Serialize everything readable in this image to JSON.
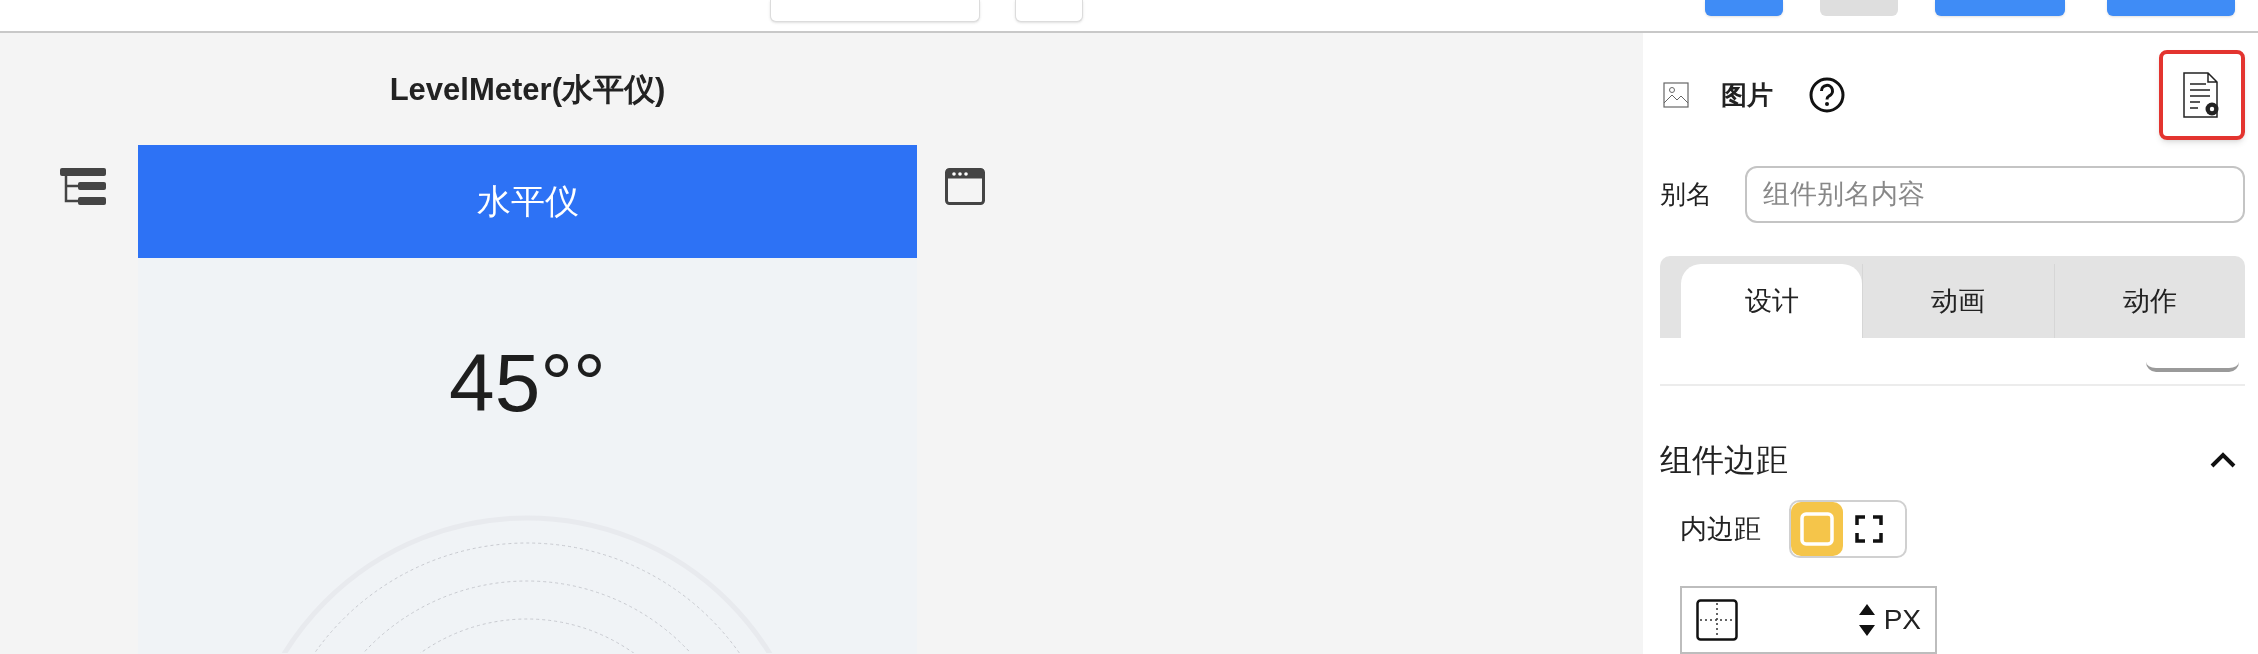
{
  "toolbar": {
    "controls": [
      {
        "kind": "select"
      },
      {
        "kind": "icon"
      },
      {
        "kind": "primary"
      },
      {
        "kind": "secondary"
      },
      {
        "kind": "primary"
      },
      {
        "kind": "primary"
      }
    ]
  },
  "canvas": {
    "title": "LevelMeter(水平仪)",
    "screen": {
      "header": "水平仪",
      "reading": "45°°"
    }
  },
  "inspector": {
    "component": "图片",
    "alias": {
      "label": "别名",
      "placeholder": "组件别名内容"
    },
    "tabs": [
      {
        "label": "设计",
        "selected": true
      },
      {
        "label": "动画",
        "selected": false
      },
      {
        "label": "动作",
        "selected": false
      }
    ],
    "section": {
      "title": "组件边距",
      "expanded": true,
      "padding": {
        "label": "内边距",
        "modes": [
          {
            "kind": "uniform",
            "selected": true
          },
          {
            "kind": "separate",
            "selected": false
          }
        ],
        "unit": "PX"
      }
    }
  }
}
